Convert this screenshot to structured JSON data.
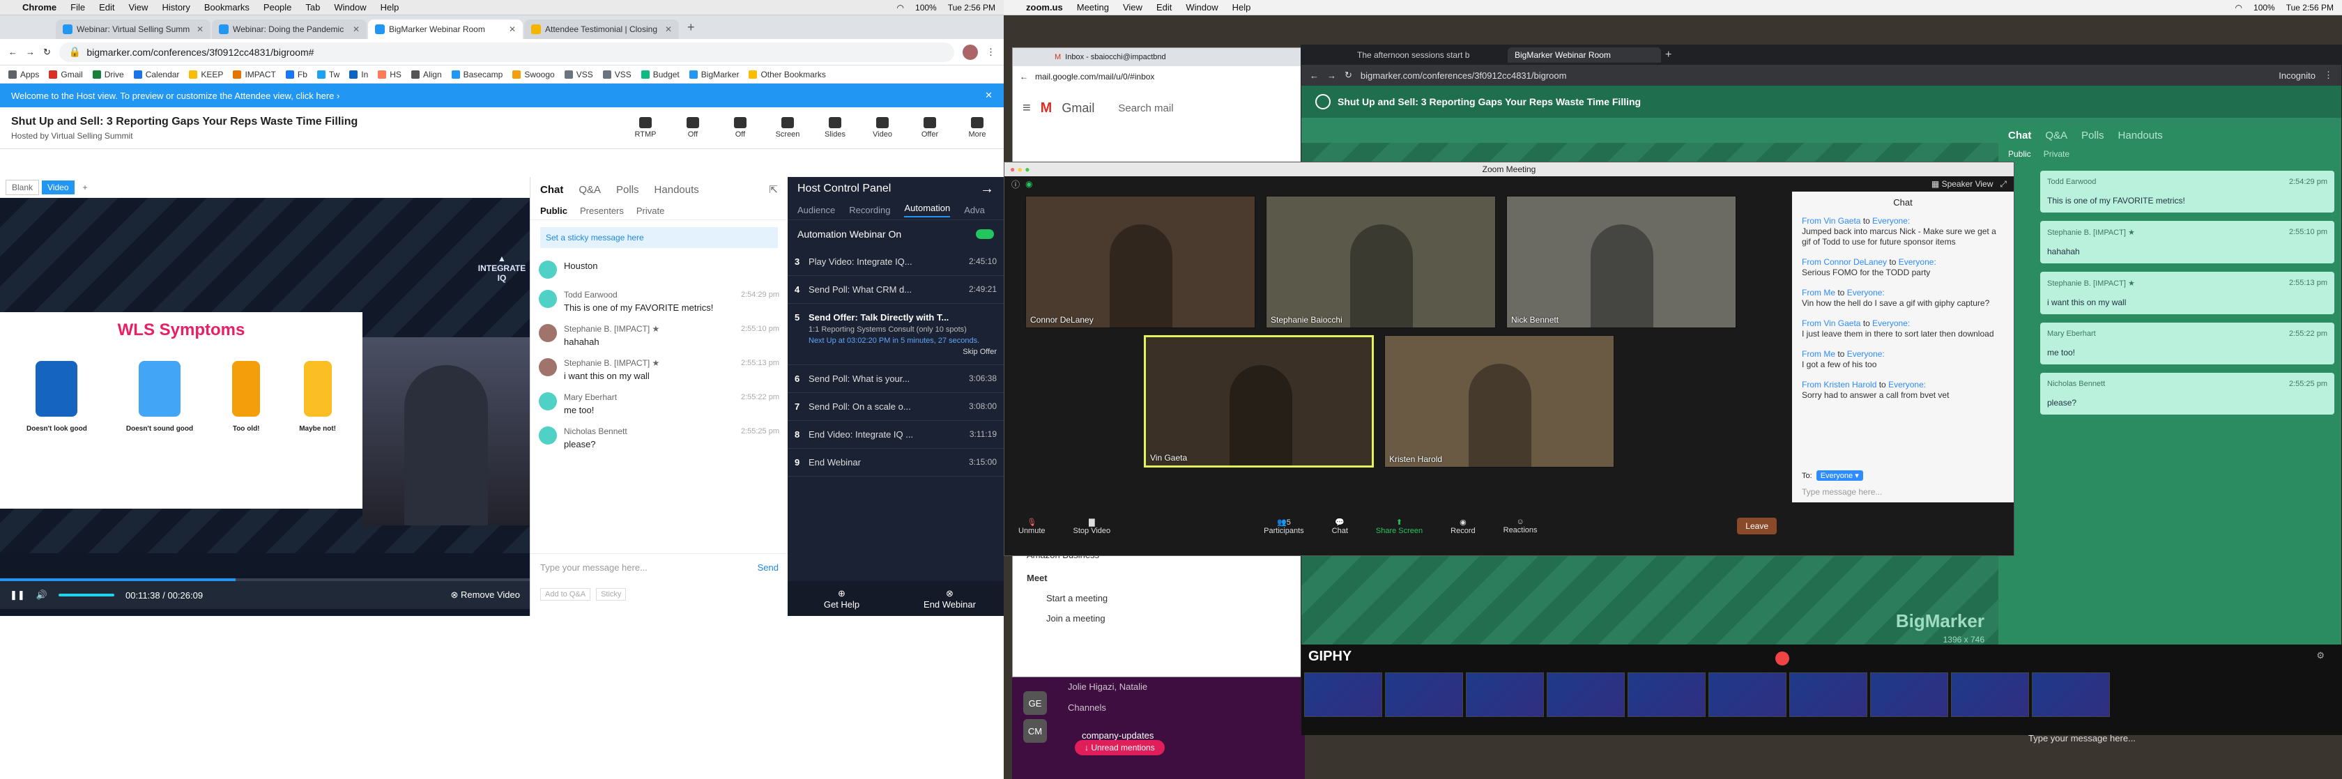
{
  "left_window": {
    "menubar": {
      "items": [
        "Chrome",
        "File",
        "Edit",
        "View",
        "History",
        "Bookmarks",
        "People",
        "Tab",
        "Window",
        "Help"
      ],
      "battery": "100%",
      "clock": "Tue 2:56 PM"
    },
    "tabs": [
      {
        "title": "Webinar: Virtual Selling Summ",
        "color": "#2196f3"
      },
      {
        "title": "Webinar: Doing the Pandemic",
        "color": "#2196f3"
      },
      {
        "title": "BigMarker Webinar Room",
        "color": "#2196f3"
      },
      {
        "title": "Attendee Testimonial | Closing",
        "color": "#f4b400"
      }
    ],
    "url": "bigmarker.com/conferences/3f0912cc4831/bigroom#",
    "bookmarks": [
      "Apps",
      "Gmail",
      "Drive",
      "Calendar",
      "KEEP",
      "IMPACT",
      "Fb",
      "Tw",
      "In",
      "HS",
      "Align",
      "Basecamp",
      "Swoogo",
      "VSS",
      "VSS",
      "Budget",
      "BigMarker",
      "Other Bookmarks"
    ],
    "notice": "Welcome to the Host view. To preview or customize the Attendee view, click here ›",
    "webinar_title": "Shut Up and Sell: 3 Reporting Gaps Your Reps Waste Time Filling",
    "hosted_by": "Hosted by Virtual Selling Summit",
    "tools": [
      {
        "label": "RTMP"
      },
      {
        "label": "Off"
      },
      {
        "label": "Off"
      },
      {
        "label": "Screen"
      },
      {
        "label": "Slides"
      },
      {
        "label": "Video"
      },
      {
        "label": "Offer"
      },
      {
        "label": "More"
      }
    ],
    "stage_tabs": [
      "Blank",
      "Video",
      "+"
    ],
    "slide": {
      "heading": "WLS Symptoms",
      "brand": "INTEGRATE IQ",
      "captions": [
        "Doesn't look good",
        "Doesn't sound good",
        "Too old!",
        "Maybe not!"
      ]
    },
    "player": {
      "time": "00:11:38 / 00:26:09",
      "remove": "Remove Video",
      "progress": 0.445
    },
    "chat": {
      "tabs": [
        "Chat",
        "Q&A",
        "Polls",
        "Handouts"
      ],
      "subtabs": [
        "Public",
        "Presenters",
        "Private"
      ],
      "sticky": "Set a sticky message here",
      "messages": [
        {
          "name": "",
          "time": "",
          "text": "Houston",
          "color": "#4fd1c5"
        },
        {
          "name": "Todd Earwood",
          "time": "2:54:29 pm",
          "text": "This is one of my FAVORITE metrics!",
          "color": "#4fd1c5"
        },
        {
          "name": "Stephanie B. [IMPACT] ★",
          "time": "2:55:10 pm",
          "text": "hahahah",
          "color": "#a0746a"
        },
        {
          "name": "Stephanie B. [IMPACT] ★",
          "time": "2:55:13 pm",
          "text": "i want this on my wall",
          "color": "#a0746a"
        },
        {
          "name": "Mary Eberhart",
          "time": "2:55:22 pm",
          "text": "me too!",
          "color": "#4fd1c5"
        },
        {
          "name": "Nicholas Bennett",
          "time": "2:55:25 pm",
          "text": "please?",
          "color": "#4fd1c5"
        }
      ],
      "placeholder": "Type your message here...",
      "send": "Send",
      "footer": [
        "Add to Q&A",
        "Sticky"
      ]
    },
    "host_panel": {
      "title": "Host Control Panel",
      "tabs": [
        "Audience",
        "Recording",
        "Automation",
        "Adva"
      ],
      "automation": "Automation Webinar On",
      "items": [
        {
          "n": "3",
          "text": "Play Video: Integrate IQ...",
          "time": "2:45:10"
        },
        {
          "n": "4",
          "text": "Send Poll: What CRM d...",
          "time": "2:49:21"
        },
        {
          "n": "5",
          "text": "Send Offer: Talk Directly with T...",
          "time": "",
          "sub": "1:1 Reporting Systems Consult (only 10 spots)",
          "next": "Next Up at 03:02:20 PM in 5 minutes, 27 seconds.",
          "skip": "Skip Offer"
        },
        {
          "n": "6",
          "text": "Send Poll: What is your...",
          "time": "3:06:38"
        },
        {
          "n": "7",
          "text": "Send Poll: On a scale o...",
          "time": "3:08:00"
        },
        {
          "n": "8",
          "text": "End Video: Integrate IQ ...",
          "time": "3:11:19"
        },
        {
          "n": "9",
          "text": "End Webinar",
          "time": "3:15:00"
        }
      ],
      "help": "Get Help",
      "end": "End Webinar"
    }
  },
  "right_window": {
    "menubar": {
      "items": [
        "zoom.us",
        "Meeting",
        "View",
        "Edit",
        "Window",
        "Help"
      ],
      "battery": "100%",
      "clock": "Tue 2:56 PM"
    },
    "gmail": {
      "tab": "Inbox - sbaiocchi@impactbnd",
      "url": "mail.google.com/mail/u/0/#inbox",
      "search": "Search mail",
      "sidebar": [
        "Amazon Business"
      ],
      "meet": "Meet",
      "start": "Start a meeting",
      "join": "Join a meeting"
    },
    "slack": {
      "people": "Jolie Higazi, Natalie",
      "channels": "Channels",
      "unread": "↓ Unread mentions",
      "company": "company-updates",
      "ge": "GE",
      "cm": "CM"
    },
    "bm2": {
      "tabs": [
        "The afternoon sessions start b",
        "BigMarker Webinar Room"
      ],
      "url": "bigmarker.com/conferences/3f0912cc4831/bigroom",
      "incognito": "Incognito",
      "title": "Shut Up and Sell: 3 Reporting Gaps Your Reps Waste Time Filling",
      "size": "1396 x 746",
      "brand": "BigMarker",
      "chat_tabs": [
        "Chat",
        "Q&A",
        "Polls",
        "Handouts"
      ],
      "sub": [
        "Public",
        "Private"
      ],
      "messages": [
        {
          "name": "Todd Earwood",
          "time": "2:54:29 pm",
          "text": "This is one of my FAVORITE metrics!"
        },
        {
          "name": "Stephanie B. [IMPACT] ★",
          "time": "2:55:10 pm",
          "text": "hahahah"
        },
        {
          "name": "Stephanie B. [IMPACT] ★",
          "time": "2:55:13 pm",
          "text": "i want this on my wall"
        },
        {
          "name": "Mary Eberhart",
          "time": "2:55:22 pm",
          "text": "me too!"
        },
        {
          "name": "Nicholas Bennett",
          "time": "2:55:25 pm",
          "text": "please?"
        }
      ],
      "placeholder": "Type your message here..."
    },
    "zoom": {
      "title": "Zoom Meeting",
      "view": "Speaker View",
      "participants": [
        "Connor DeLaney",
        "Stephanie Baiocchi",
        "Nick Bennett",
        "Vin Gaeta",
        "Kristen Harold"
      ],
      "chat_title": "Chat",
      "chat": [
        {
          "from": "From Vin Gaeta",
          "to": "Everyone:",
          "text": "Jumped back into marcus Nick - Make sure we get a gif of Todd to use for future sponsor items"
        },
        {
          "from": "From Connor DeLaney",
          "to": "Everyone:",
          "text": "Serious FOMO for the TODD party"
        },
        {
          "from": "From Me",
          "to": "Everyone:",
          "text": "Vin how the hell do I save a gif with giphy capture?"
        },
        {
          "from": "From Vin Gaeta",
          "to": "Everyone:",
          "text": "I just leave them in there to sort later then download"
        },
        {
          "from": "From Me",
          "to": "Everyone:",
          "text": "I got a few of his too"
        },
        {
          "from": "From Kristen Harold",
          "to": "Everyone:",
          "text": "Sorry had to answer a call from bvet vet"
        }
      ],
      "to": "To:",
      "everyone": "Everyone ▾",
      "placeholder": "Type message here...",
      "controls": [
        "Unmute",
        "Stop Video",
        "Participants",
        "Chat",
        "Share Screen",
        "Record",
        "Reactions"
      ],
      "participants_count": "5",
      "leave": "Leave"
    },
    "giphy": {
      "title": "GIPHY"
    },
    "slack_input": "Type your message here..."
  }
}
